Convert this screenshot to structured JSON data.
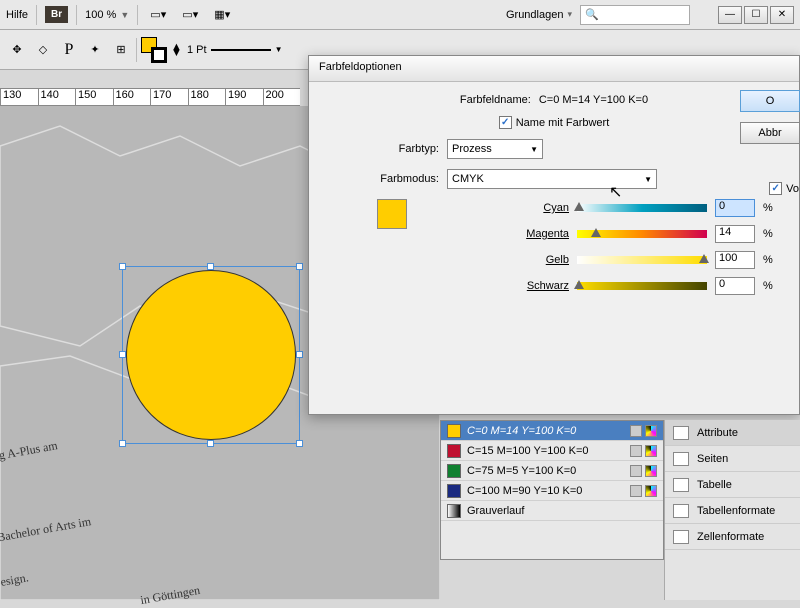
{
  "topbar": {
    "help": "Hilfe",
    "br": "Br",
    "zoom": "100 %",
    "basics": "Grundlagen"
  },
  "toolbar": {
    "stroke_weight": "1 Pt"
  },
  "ruler": [
    "130",
    "140",
    "150",
    "160",
    "170",
    "180",
    "190",
    "200"
  ],
  "canvas_text": {
    "t1": "eig A-Plus am",
    "t2": ". Grades Bachelor of Arts im",
    "t3": "n und Design.",
    "t4": "in Göttingen"
  },
  "dialog": {
    "title": "Farbfeldoptionen",
    "name_label": "Farbfeldname:",
    "name_value": "C=0 M=14 Y=100 K=0",
    "name_with_value": "Name mit Farbwert",
    "colortype_label": "Farbtyp:",
    "colortype_value": "Prozess",
    "colormode_label": "Farbmodus:",
    "colormode_value": "CMYK",
    "sliders": {
      "cyan_label": "Cyan",
      "cyan_value": "0",
      "magenta_label": "Magenta",
      "magenta_value": "14",
      "yellow_label": "Gelb",
      "yellow_value": "100",
      "black_label": "Schwarz",
      "black_value": "0"
    },
    "pct": "%",
    "btn_ok": "O",
    "btn_cancel": "Abbr",
    "preview_check": "Vo"
  },
  "swatches": [
    {
      "color": "#ffcd00",
      "label": "C=0 M=14 Y=100 K=0",
      "sel": true
    },
    {
      "color": "#c01030",
      "label": "C=15 M=100 Y=100 K=0",
      "sel": false
    },
    {
      "color": "#108030",
      "label": "C=75 M=5 Y=100 K=0",
      "sel": false
    },
    {
      "color": "#1a2a80",
      "label": "C=100 M=90 Y=10 K=0",
      "sel": false
    },
    {
      "color": "linear-gradient(90deg,#fff,#000)",
      "label": "Grauverlauf",
      "sel": false
    }
  ],
  "right_panel": {
    "items": [
      "Attribute",
      "Seiten",
      "Tabelle",
      "Tabellenformate",
      "Zellenformate"
    ]
  }
}
